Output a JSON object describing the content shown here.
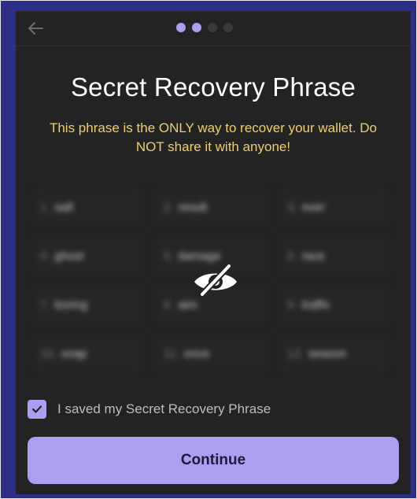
{
  "header": {
    "back_icon": "arrow-left-icon",
    "step_dots": [
      true,
      true,
      false,
      false
    ]
  },
  "title": "Secret Recovery Phrase",
  "warning": "This phrase is the ONLY way to recover your wallet. Do NOT share it with anyone!",
  "phrase": [
    {
      "n": "1.",
      "w": "salt"
    },
    {
      "n": "2.",
      "w": "result"
    },
    {
      "n": "3.",
      "w": "over"
    },
    {
      "n": "4.",
      "w": "ghost"
    },
    {
      "n": "5.",
      "w": "damage"
    },
    {
      "n": "6.",
      "w": "race"
    },
    {
      "n": "7.",
      "w": "boring"
    },
    {
      "n": "8.",
      "w": "aim"
    },
    {
      "n": "9.",
      "w": "traffic"
    },
    {
      "n": "10.",
      "w": "soap"
    },
    {
      "n": "11.",
      "w": "once"
    },
    {
      "n": "12.",
      "w": "season"
    }
  ],
  "reveal_icon": "eye-slash-icon",
  "saved_checkbox": {
    "checked": true,
    "label": "I saved my Secret Recovery Phrase"
  },
  "continue_label": "Continue",
  "colors": {
    "accent": "#ab9ff2",
    "warning": "#f0cf67",
    "panel": "#232323",
    "background": "#2b2f86"
  }
}
